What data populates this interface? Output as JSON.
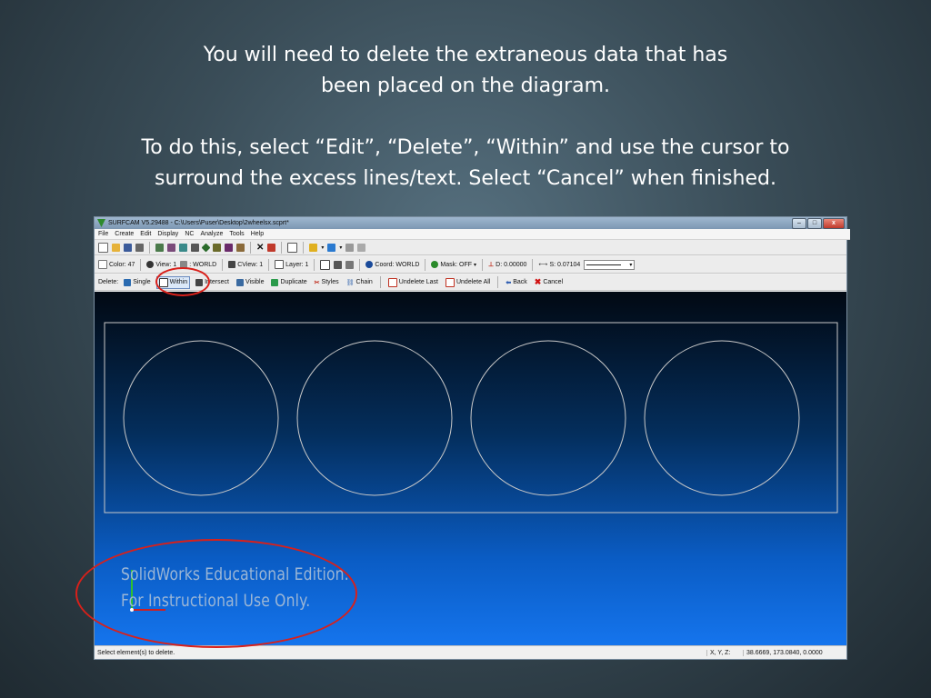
{
  "slide": {
    "para1_line1": "You will need to delete the extraneous data that has",
    "para1_line2": "been placed on the diagram.",
    "para2_line1": "To do this, select “Edit”, “Delete”, “Within” and use the cursor to",
    "para2_line2": "surround the excess lines/text.  Select “Cancel” when finished."
  },
  "window": {
    "title": "SURFCAM V5.29488 - C:\\Users\\Puser\\Desktop\\2wheelsx.scprt*",
    "minimize": "–",
    "maximize": "□",
    "close": "x"
  },
  "menu": [
    "File",
    "Create",
    "Edit",
    "Display",
    "NC",
    "Analyze",
    "Tools",
    "Help"
  ],
  "toolbar2": {
    "color": "Color: 47",
    "view": "View: 1",
    "world": ": WORLD",
    "cview": "CView: 1",
    "layer": "Layer: 1",
    "coord": "Coord: WORLD",
    "mask": "Mask: OFF",
    "d": "D: 0.00000",
    "s": "S: 0.07104"
  },
  "toolbar3": {
    "label": "Delete:",
    "single": "Single",
    "within": "Within",
    "intersect": "Intersect",
    "visible": "Visible",
    "duplicate": "Duplicate",
    "styles": "Styles",
    "chain": "Chain",
    "undelete_last": "Undelete Last",
    "undelete_all": "Undelete All",
    "back": "Back",
    "cancel": "Cancel"
  },
  "viewport": {
    "watermark_line1": "SolidWorks Educational Edition.",
    "watermark_line2": "For Instructional Use Only."
  },
  "status": {
    "message": "Select element(s) to delete.",
    "coord_label": "X, Y, Z:",
    "coord_value": "38.6669, 173.0840, 0.0000"
  },
  "colors": {
    "annotation": "#d9201a",
    "geometry_line": "#c9c9c9",
    "viewport_top": "#020913",
    "viewport_bottom": "#1575ee"
  }
}
